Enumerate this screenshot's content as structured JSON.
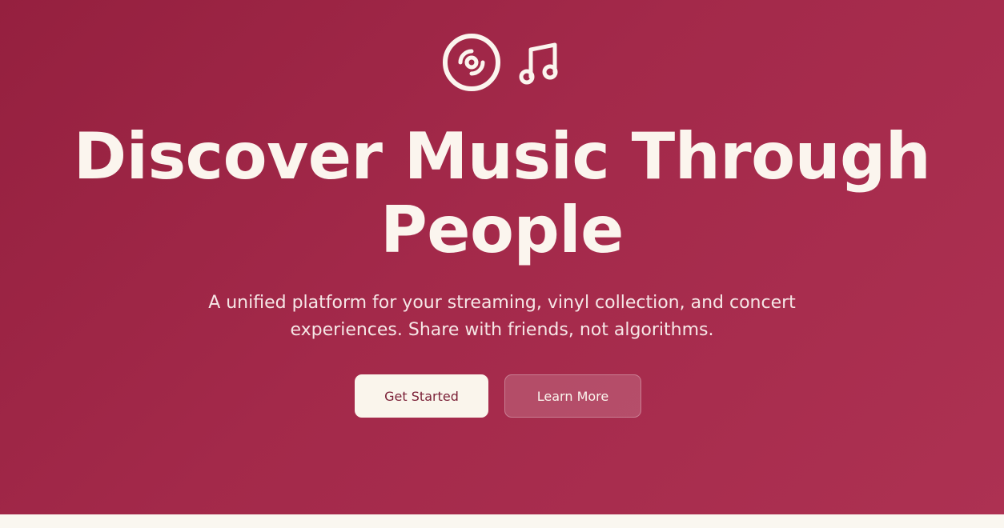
{
  "hero": {
    "icons": [
      "disc-icon",
      "music-note-icon"
    ],
    "title_line1": "Discover Music Through",
    "title_line2": "People",
    "subtitle": "A unified platform for your streaming, vinyl collection, and concert experiences. Share with friends, not algorithms.",
    "primary_button": "Get Started",
    "secondary_button": "Learn More"
  },
  "colors": {
    "hero_gradient_start": "#95203f",
    "hero_gradient_end": "#ad3152",
    "cream": "#faf7f0",
    "primary_button_text": "#7a1f36"
  }
}
